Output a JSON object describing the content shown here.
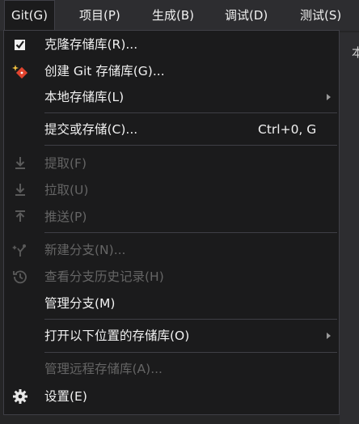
{
  "menubar": {
    "items": [
      {
        "label": "Git(G)"
      },
      {
        "label": "项目(P)"
      },
      {
        "label": "生成(B)"
      },
      {
        "label": "调试(D)"
      },
      {
        "label": "测试(S)"
      }
    ]
  },
  "background_hint": "本",
  "menu": {
    "items": [
      {
        "label": "克隆存储库(R)...",
        "icon": "clone-repository-icon",
        "enabled": true
      },
      {
        "label": "创建 Git 存储库(G)...",
        "icon": "create-git-repository-icon",
        "enabled": true
      },
      {
        "label": "本地存储库(L)",
        "submenu": true,
        "enabled": true
      },
      {
        "label": "提交或存储(C)...",
        "shortcut": "Ctrl+0, G",
        "enabled": true
      },
      {
        "label": "提取(F)",
        "icon": "fetch-icon",
        "enabled": false
      },
      {
        "label": "拉取(U)",
        "icon": "pull-icon",
        "enabled": false
      },
      {
        "label": "推送(P)",
        "icon": "push-icon",
        "enabled": false
      },
      {
        "label": "新建分支(N)...",
        "icon": "new-branch-icon",
        "enabled": false
      },
      {
        "label": "查看分支历史记录(H)",
        "icon": "history-icon",
        "enabled": false
      },
      {
        "label": "管理分支(M)",
        "enabled": true
      },
      {
        "label": "打开以下位置的存储库(O)",
        "submenu": true,
        "enabled": true
      },
      {
        "label": "管理远程存储库(A)...",
        "enabled": false
      },
      {
        "label": "设置(E)",
        "icon": "gear-icon",
        "enabled": true
      }
    ]
  }
}
